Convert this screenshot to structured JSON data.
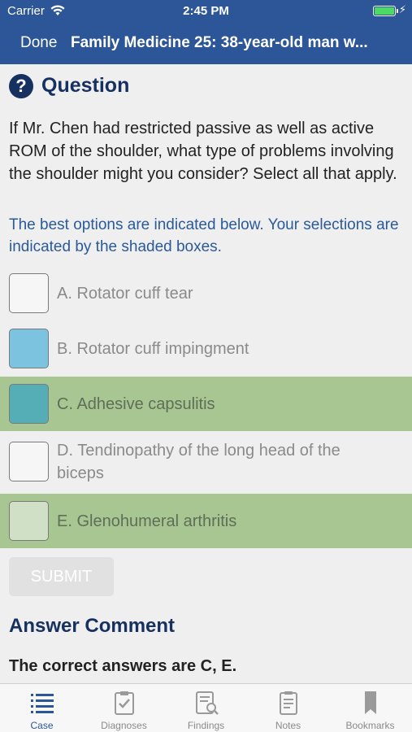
{
  "status_bar": {
    "carrier": "Carrier",
    "time": "2:45 PM"
  },
  "nav": {
    "done_label": "Done",
    "title": "Family Medicine 25: 38-year-old man w..."
  },
  "question": {
    "heading": "Question",
    "icon": "question-circle-icon",
    "text": "If Mr. Chen had restricted passive as well as active ROM of the shoulder, what type of problems involving the shoulder might you consider? Select all that apply.",
    "instruction": "The best options are indicated below. Your selections are indicated by the shaded boxes."
  },
  "options": [
    {
      "label": "A. Rotator cuff tear",
      "selected": false,
      "correct": false,
      "box_color": "#f6f6f6"
    },
    {
      "label": "B. Rotator cuff impingment",
      "selected": true,
      "correct": false,
      "box_color": "#7cc3e0"
    },
    {
      "label": "C. Adhesive capsulitis",
      "selected": true,
      "correct": true,
      "box_color": "#55aeb6"
    },
    {
      "label": "D. Tendinopathy of the long head of the biceps",
      "selected": false,
      "correct": false,
      "box_color": "#f6f6f6"
    },
    {
      "label": "E. Glenohumeral arthritis",
      "selected": false,
      "correct": true,
      "box_color": "#cfe0c6"
    }
  ],
  "submit_label": "SUBMIT",
  "answer": {
    "heading": "Answer Comment",
    "correct_text": "The correct answers are C, E."
  },
  "tabs": [
    {
      "label": "Case",
      "icon": "list-icon",
      "active": true
    },
    {
      "label": "Diagnoses",
      "icon": "clipboard-check-icon",
      "active": false
    },
    {
      "label": "Findings",
      "icon": "document-search-icon",
      "active": false
    },
    {
      "label": "Notes",
      "icon": "notes-icon",
      "active": false
    },
    {
      "label": "Bookmarks",
      "icon": "bookmark-icon",
      "active": false
    }
  ],
  "colors": {
    "nav_blue": "#2c5697",
    "heading_navy": "#16305f",
    "instruction_blue": "#2a5a97",
    "correct_green": "#a7c691"
  }
}
